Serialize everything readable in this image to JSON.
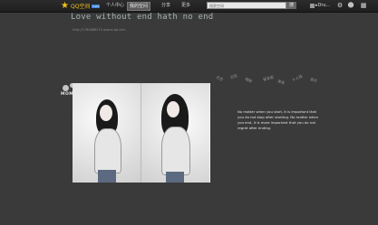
{
  "topbar": {
    "brand": "QQ空间",
    "brand_tag": "beta",
    "nav": [
      {
        "label": "个人中心"
      },
      {
        "label": "我的空间"
      },
      {
        "label": "分享"
      },
      {
        "label": "更多"
      }
    ],
    "search_placeholder": "搜索空间",
    "search_button": "搜",
    "user_name": "▸Dru..."
  },
  "blog": {
    "title": "Love without end hath no end",
    "url": "http://1784888215.qzone.qq.com"
  },
  "badge": {
    "text": "MOMO"
  },
  "tags": [
    "主页",
    "日志",
    "相册",
    "留言板",
    "说说",
    "个人档",
    "音乐"
  ],
  "quote": "No matter when you start, it is important that you do not stop after starting. No matter when you end, it is more important that you do not regret after ending.",
  "colors": {
    "background": "#3a3a3a",
    "title": "#a7b3b5",
    "accent_star": "#f3c21b"
  }
}
